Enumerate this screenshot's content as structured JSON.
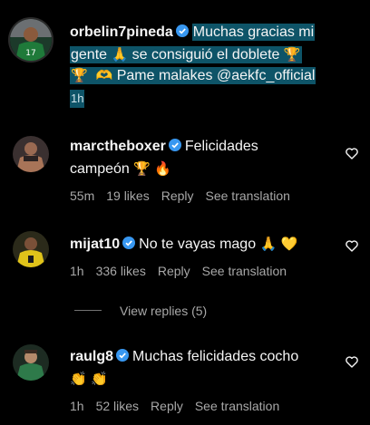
{
  "post": {
    "username": "orbelin7pineda",
    "caption_line1": "Muchas gracias mi",
    "caption_line2_a": "gente",
    "caption_line2_b": "se consiguió el doblete",
    "caption_line3": "Pame malakes @aekfc_official",
    "time": "1h",
    "avatar_number": "17"
  },
  "comments": [
    {
      "username": "marctheboxer",
      "text_line1": "Felicidades",
      "text_line2": "campeón",
      "time": "55m",
      "likes": "19 likes",
      "reply": "Reply",
      "translate": "See translation"
    },
    {
      "username": "mijat10",
      "text_line1": "No te vayas mago",
      "time": "1h",
      "likes": "336 likes",
      "reply": "Reply",
      "translate": "See translation"
    },
    {
      "username": "raulg8",
      "text_line1": "Muchas felicidades cocho",
      "time": "1h",
      "likes": "52 likes",
      "reply": "Reply",
      "translate": "See translation"
    }
  ],
  "view_replies": "View replies (5)",
  "icons": {
    "verified": "verified-badge-icon",
    "heart": "heart-outline-icon",
    "trophy": "trophy-emoji",
    "praying": "praying-hands-emoji",
    "fire": "fire-emoji",
    "yellow_heart": "yellow-heart-emoji",
    "heart_hands": "heart-hands-emoji",
    "clap": "clapping-hands-emoji"
  },
  "colors": {
    "background": "#000000",
    "highlight": "#0e5468",
    "verified": "#3897f0",
    "secondary_text": "#a8a8a8"
  }
}
